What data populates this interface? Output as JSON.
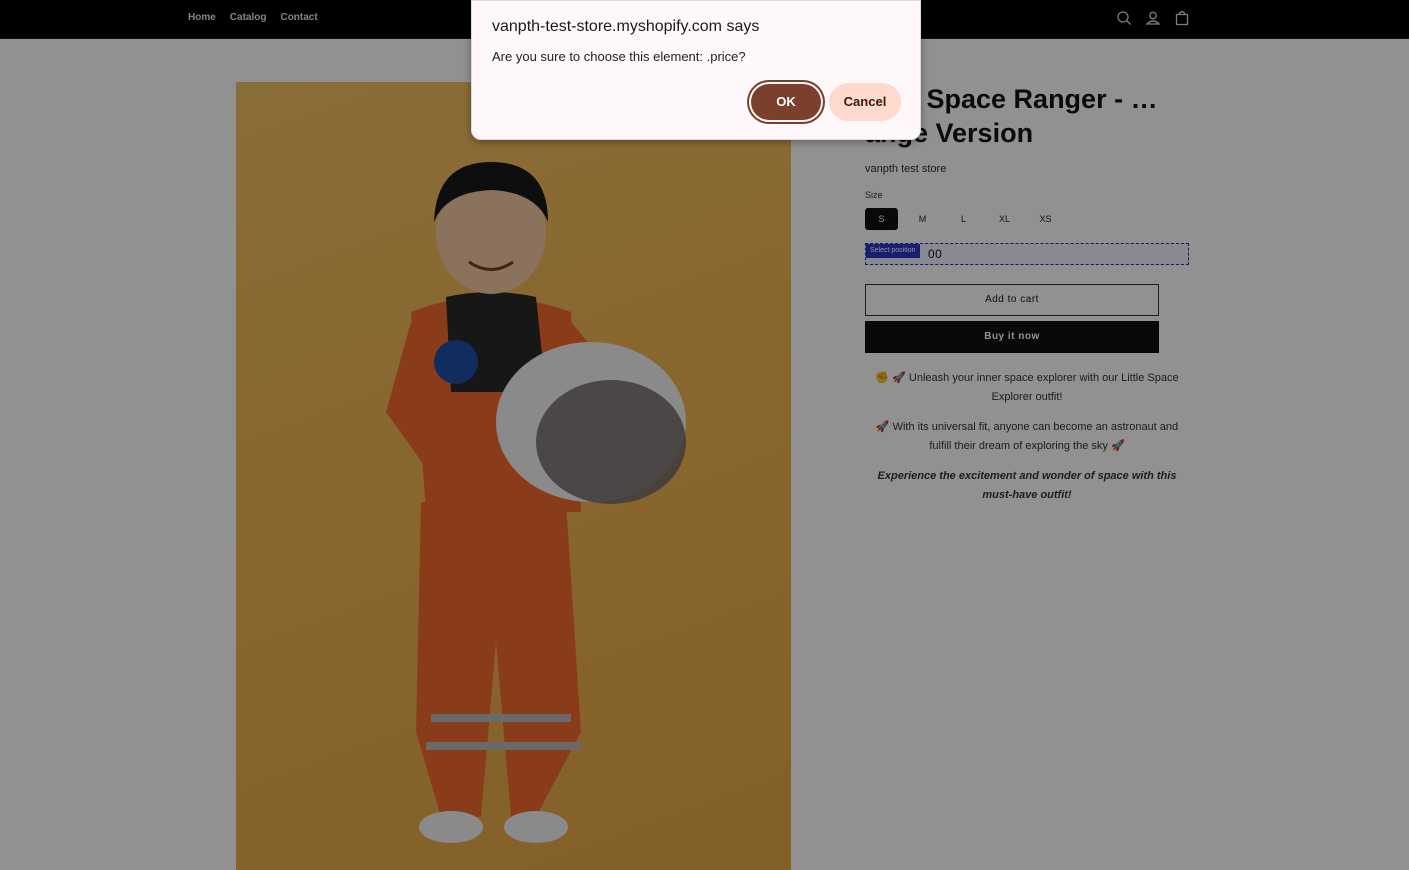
{
  "nav": {
    "items": [
      "Home",
      "Catalog",
      "Contact"
    ]
  },
  "header_icons": [
    "search-icon",
    "account-icon",
    "cart-icon"
  ],
  "product": {
    "title": "…or Space Ranger - …ange Version",
    "vendor": "vanpth test store",
    "size_label": "Size",
    "sizes": [
      "S",
      "M",
      "L",
      "XL",
      "XS"
    ],
    "selected_size": "S",
    "price_visible": "00",
    "selection_tag": "Select position",
    "add_to_cart": "Add to cart",
    "buy_now": "Buy it now",
    "desc1": "✊ 🚀 Unleash your inner space explorer with our Little Space Explorer outfit!",
    "desc2": "🚀 With its universal fit, anyone can become an astronaut and fulfill their dream of exploring the sky 🚀",
    "desc3": "Experience the excitement and wonder of space with this must-have outfit!"
  },
  "dialog": {
    "title": "vanpth-test-store.myshopify.com says",
    "message": "Are you sure to choose this element: .price?",
    "ok": "OK",
    "cancel": "Cancel"
  },
  "colors": {
    "ok": "#7a3f2d",
    "cancel": "#ffd9cd",
    "selection": "#2b36c9"
  }
}
